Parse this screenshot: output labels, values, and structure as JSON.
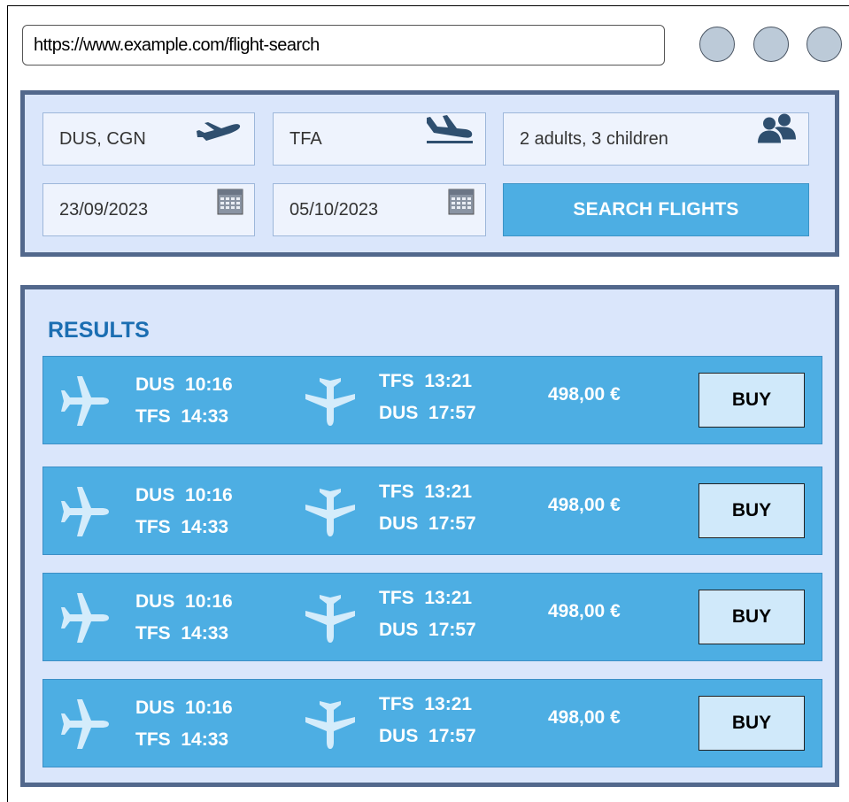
{
  "browser": {
    "url": "https://www.example.com/flight-search",
    "window_buttons": [
      "window-button",
      "window-button",
      "window-button"
    ]
  },
  "search": {
    "from": "DUS, CGN",
    "to": "TFA",
    "passengers": "2 adults, 3 children",
    "depart_date": "23/09/2023",
    "return_date": "05/10/2023",
    "search_label": "SEARCH FLIGHTS",
    "icons": {
      "from": "takeoff-icon",
      "to": "landing-icon",
      "passengers": "people-icon",
      "date": "calendar-icon"
    }
  },
  "results": {
    "title": "RESULTS",
    "rows": [
      {
        "outbound_from": "DUS",
        "outbound_dep": "10:16",
        "outbound_to": "TFS",
        "outbound_arr": "14:33",
        "return_from": "TFS",
        "return_dep": "13:21",
        "return_to": "DUS",
        "return_arr": "17:57",
        "price": "498,00 €",
        "buy_label": "BUY"
      },
      {
        "outbound_from": "DUS",
        "outbound_dep": "10:16",
        "outbound_to": "TFS",
        "outbound_arr": "14:33",
        "return_from": "TFS",
        "return_dep": "13:21",
        "return_to": "DUS",
        "return_arr": "17:57",
        "price": "498,00 €",
        "buy_label": "BUY"
      },
      {
        "outbound_from": "DUS",
        "outbound_dep": "10:16",
        "outbound_to": "TFS",
        "outbound_arr": "14:33",
        "return_from": "TFS",
        "return_dep": "13:21",
        "return_to": "DUS",
        "return_arr": "17:57",
        "price": "498,00 €",
        "buy_label": "BUY"
      },
      {
        "outbound_from": "DUS",
        "outbound_dep": "10:16",
        "outbound_to": "TFS",
        "outbound_arr": "14:33",
        "return_from": "TFS",
        "return_dep": "13:21",
        "return_to": "DUS",
        "return_arr": "17:57",
        "price": "498,00 €",
        "buy_label": "BUY"
      }
    ]
  },
  "colors": {
    "panel_border": "#52688c",
    "panel_bg": "#dae6fb",
    "accent": "#4daee3",
    "title": "#1b6eb2",
    "buy_bg": "#d0e9fa"
  }
}
